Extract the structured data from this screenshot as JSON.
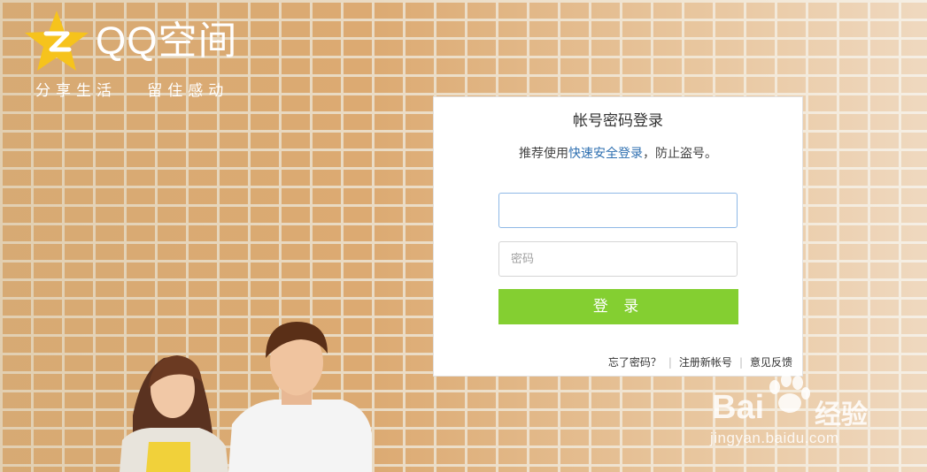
{
  "logo": {
    "brand_text": "QQ空间",
    "slogan": "分享生活   留住感动",
    "icon": "qq-zone-star-icon"
  },
  "login": {
    "title": "帐号密码登录",
    "tip_prefix": "推荐使用",
    "tip_link": "快速安全登录",
    "tip_suffix": "，防止盗号。",
    "account_value": "",
    "password_placeholder": "密码",
    "submit_label": "登 录",
    "links": {
      "forgot": "忘了密码？",
      "register": "注册新帐号",
      "feedback": "意见反馈"
    }
  },
  "watermark": {
    "brand": "Bai",
    "brand_cn": "经验",
    "url": "jingyan.baidu.com"
  },
  "colors": {
    "accent_green": "#84cf31",
    "link_blue": "#2e6fb0",
    "logo_yellow": "#f6c31c"
  }
}
